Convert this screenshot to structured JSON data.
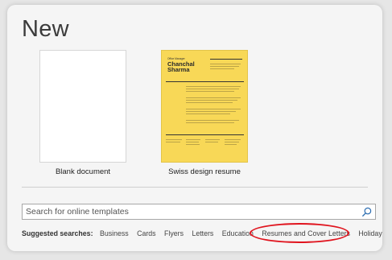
{
  "page": {
    "title": "New"
  },
  "templates": [
    {
      "label": "Blank document"
    },
    {
      "label": "Swiss design resume",
      "preview": {
        "subtitle": "Office Manager",
        "name_line1": "Chanchal",
        "name_line2": "Sharma",
        "accent_color": "#f8d857"
      }
    }
  ],
  "search": {
    "placeholder": "Search for online templates",
    "icon": "search-icon"
  },
  "suggested": {
    "label": "Suggested searches:",
    "items": [
      "Business",
      "Cards",
      "Flyers",
      "Letters",
      "Education",
      "Resumes and Cover Letters",
      "Holiday"
    ]
  },
  "annotation": {
    "color": "#e0141e"
  }
}
